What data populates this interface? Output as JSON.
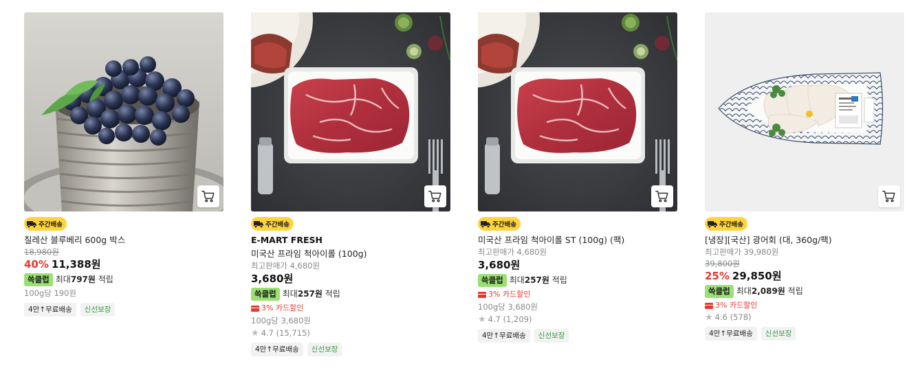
{
  "products": [
    {
      "title": "칠레산 블루베리 600g 박스",
      "badge": "주간배송",
      "orig_price": "18,980원",
      "discount": "40%",
      "price": "11,388원",
      "reward_chip": "쓱클럽",
      "reward_prefix": "최대",
      "reward_amount": "797원",
      "reward_suffix": "적립",
      "unit_price": "100g당 190원",
      "tags": [
        "4만↑무료배송",
        "신선보장"
      ]
    },
    {
      "brand": "E-MART FRESH",
      "title": "미국산 프라임 척아이롤 (100g)",
      "badge": "주간배송",
      "ref_price": "최고판매가 4,680원",
      "price": "3,680원",
      "reward_chip": "쓱클럽",
      "reward_prefix": "최대",
      "reward_amount": "257원",
      "reward_suffix": "적립",
      "card_discount": "3% 카드할인",
      "unit_price": "100g당 3,680원",
      "rating": "4.7 (15,715)",
      "tags": [
        "4만↑무료배송",
        "신선보장"
      ]
    },
    {
      "title": "미국산 프라임 척아이롤 ST (100g) (팩)",
      "badge": "주간배송",
      "ref_price": "최고판매가 4,680원",
      "price": "3,680원",
      "reward_chip": "쓱클럽",
      "reward_prefix": "최대",
      "reward_amount": "257원",
      "reward_suffix": "적립",
      "card_discount": "3% 카드할인",
      "unit_price": "100g당 3,680원",
      "rating": "4.7 (1,209)",
      "tags": [
        "4만↑무료배송",
        "신선보장"
      ]
    },
    {
      "title": "[냉장][국산] 광어회 (대, 360g/팩)",
      "badge": "주간배송",
      "ref_price": "최고판매가 39,980원",
      "orig_price": "39,800원",
      "discount": "25%",
      "price": "29,850원",
      "reward_chip": "쓱클럽",
      "reward_prefix": "최대",
      "reward_amount": "2,089원",
      "reward_suffix": "적립",
      "card_discount": "3% 카드할인",
      "rating": "4.6 (578)",
      "tags": [
        "4만↑무료배송",
        "신선보장"
      ]
    }
  ],
  "icons": {
    "cart": "cart-icon",
    "delivery": "truck-icon",
    "rating": "star-icon",
    "card": "credit-card-icon"
  },
  "colors": {
    "discount": "#e8372f",
    "badge_bg": "#ffd43b",
    "reward_chip_bg": "#9be072",
    "fresh_tag": "#2e9e3e"
  }
}
